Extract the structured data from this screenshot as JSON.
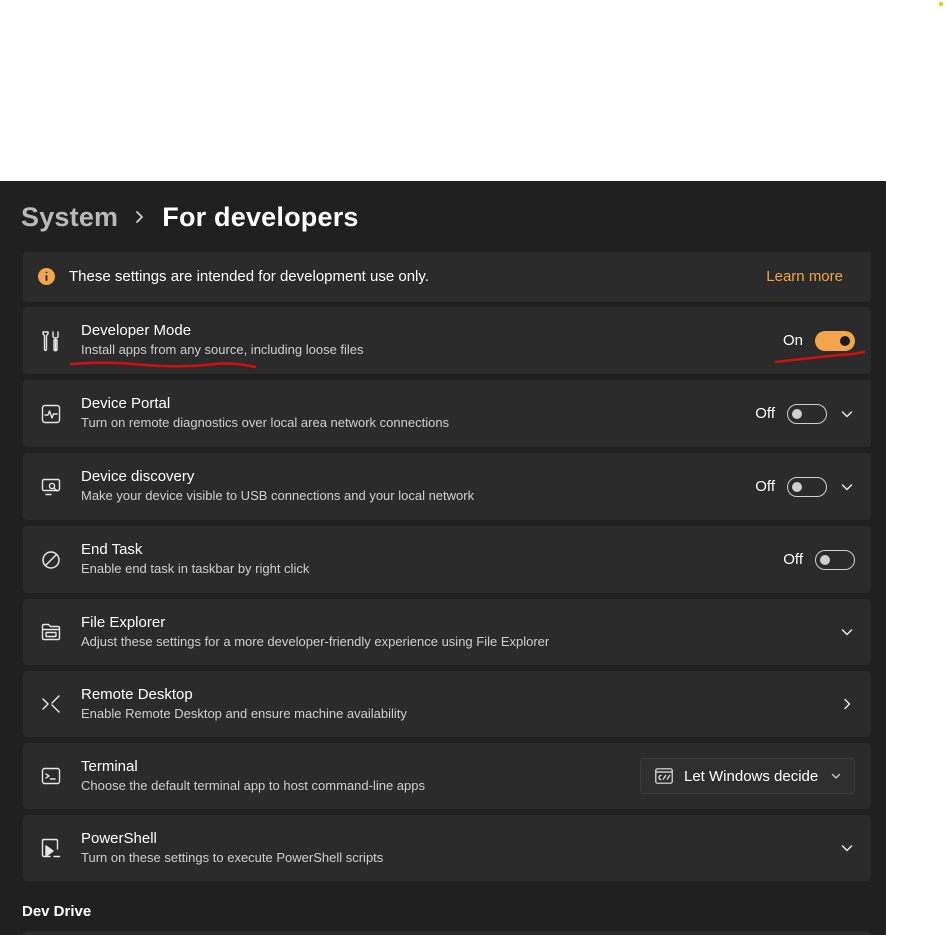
{
  "breadcrumb": {
    "parent": "System",
    "current": "For developers"
  },
  "info_bar": {
    "text": "These settings are intended for development use only.",
    "link": "Learn more"
  },
  "settings": [
    {
      "title": "Developer Mode",
      "description": "Install apps from any source, including loose files",
      "icon": "developer-tools-icon",
      "state": "On",
      "toggle_on": true,
      "expandable": false
    },
    {
      "title": "Device Portal",
      "description": "Turn on remote diagnostics over local area network connections",
      "icon": "pulse-monitor-icon",
      "state": "Off",
      "toggle_on": false,
      "expandable": true
    },
    {
      "title": "Device discovery",
      "description": "Make your device visible to USB connections and your local network",
      "icon": "device-discovery-icon",
      "state": "Off",
      "toggle_on": false,
      "expandable": true
    },
    {
      "title": "End Task",
      "description": "Enable end task in taskbar by right click",
      "icon": "prohibited-icon",
      "state": "Off",
      "toggle_on": false,
      "expandable": false
    },
    {
      "title": "File Explorer",
      "description": "Adjust these settings for a more developer-friendly experience using File Explorer",
      "icon": "folder-icon",
      "expandable": true
    },
    {
      "title": "Remote Desktop",
      "description": "Enable Remote Desktop and ensure machine availability",
      "icon": "remote-desktop-icon",
      "navigates": true
    },
    {
      "title": "Terminal",
      "description": "Choose the default terminal app to host command-line apps",
      "icon": "terminal-icon",
      "dropdown_value": "Let Windows decide"
    },
    {
      "title": "PowerShell",
      "description": "Turn on these settings to execute PowerShell scripts",
      "icon": "powershell-icon",
      "expandable": true
    }
  ],
  "section": {
    "title": "Dev Drive"
  },
  "colors": {
    "background": "#202020",
    "card": "#2b2b2b",
    "accent": "#f2a54a",
    "annotation": "#d01010"
  }
}
